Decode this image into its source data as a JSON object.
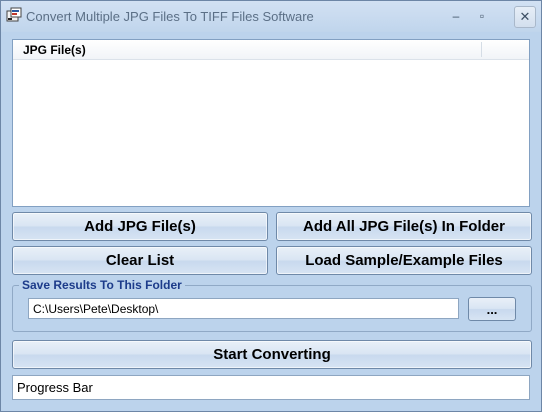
{
  "window": {
    "title": "Convert Multiple JPG Files To TIFF Files Software",
    "minimize": "–",
    "maximize": "▫",
    "close": "✕"
  },
  "file_list": {
    "column_header": "JPG File(s)",
    "rows": []
  },
  "buttons": {
    "add_files": "Add JPG File(s)",
    "add_folder": "Add All JPG File(s) In Folder",
    "clear_list": "Clear List",
    "load_sample": "Load Sample/Example Files",
    "start": "Start Converting"
  },
  "output": {
    "group_label": "Save Results To This Folder",
    "path": "C:\\Users\\Pete\\Desktop\\",
    "browse_label": "..."
  },
  "progress": {
    "label": "Progress Bar"
  }
}
